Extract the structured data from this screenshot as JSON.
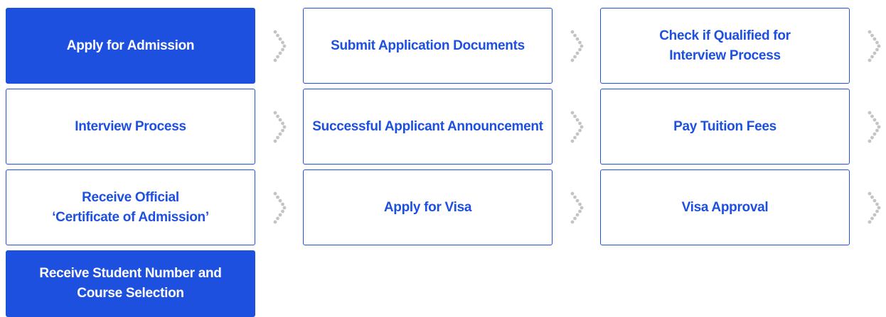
{
  "steps": [
    {
      "label": "Apply for Admission",
      "highlight": true
    },
    {
      "label": "Submit Application Documents",
      "highlight": false
    },
    {
      "label": "Check if Qualified for\nInterview Process",
      "highlight": false
    },
    {
      "label": "Interview Process",
      "highlight": false
    },
    {
      "label": "Successful Applicant Announcement",
      "highlight": false
    },
    {
      "label": "Pay Tuition Fees",
      "highlight": false
    },
    {
      "label": "Receive Official\n‘Certificate of Admission’",
      "highlight": false
    },
    {
      "label": "Apply for Visa",
      "highlight": false
    },
    {
      "label": "Visa Approval",
      "highlight": false
    },
    {
      "label": "Receive Student Number and\nCourse Selection",
      "highlight": true
    }
  ],
  "colors": {
    "accent": "#1e50e0",
    "arrow": "#c4c4c4"
  },
  "icons": {
    "connector": "chevron-right-dotted-icon"
  }
}
